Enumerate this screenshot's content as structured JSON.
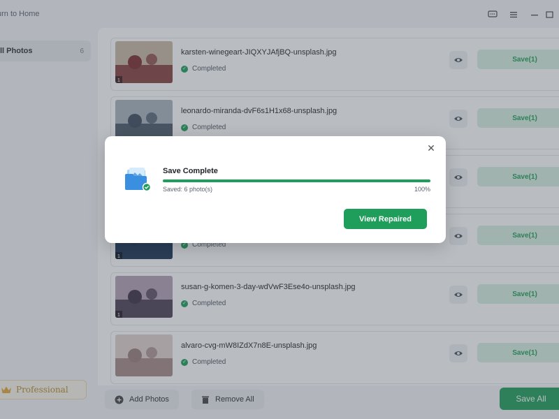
{
  "topbar": {
    "back_label": "urn to Home"
  },
  "sidebar": {
    "all_photos": {
      "label": "ll Photos",
      "count": "6"
    },
    "pro_label": "Professional"
  },
  "rows": [
    {
      "file": "karsten-winegeart-JIQXYJAfjBQ-unsplash.jpg",
      "status": "Completed",
      "save": "Save(1)",
      "thumb_colors": [
        "#7b2a2e",
        "#c9b8a5"
      ],
      "badge": "1"
    },
    {
      "file": "leonardo-miranda-dvF6s1H1x68-unsplash.jpg",
      "status": "Completed",
      "save": "Save(1)",
      "thumb_colors": [
        "#3c4a5c",
        "#a7b3bd"
      ],
      "badge": ""
    },
    {
      "file": "",
      "status": "",
      "save": "Save(1)",
      "thumb_colors": [
        "#24415e",
        "#5c7a92"
      ],
      "badge": ""
    },
    {
      "file": "",
      "status": "Completed",
      "save": "Save(1)",
      "thumb_colors": [
        "#142c4c",
        "#2e5a86"
      ],
      "badge": "1"
    },
    {
      "file": "susan-g-komen-3-day-wdVwF3Ese4o-unsplash.jpg",
      "status": "Completed",
      "save": "Save(1)",
      "thumb_colors": [
        "#3b2e45",
        "#b4a0b6"
      ],
      "badge": "1"
    },
    {
      "file": "alvaro-cvg-mW8IZdX7n8E-unsplash.jpg",
      "status": "Completed",
      "save": "Save(1)",
      "thumb_colors": [
        "#9b7e7e",
        "#e1d2d0"
      ],
      "badge": ""
    }
  ],
  "bottombar": {
    "add_label": "Add Photos",
    "remove_label": "Remove All",
    "save_all_label": "Save All"
  },
  "modal": {
    "title": "Save Complete",
    "saved_text": "Saved: 6 photo(s)",
    "percent_text": "100%",
    "progress": 1.0,
    "view_button": "View Repaired",
    "close_icon": "close-icon"
  },
  "colors": {
    "accent": "#1e9e5a",
    "accent_light": "#d9f0e2"
  }
}
